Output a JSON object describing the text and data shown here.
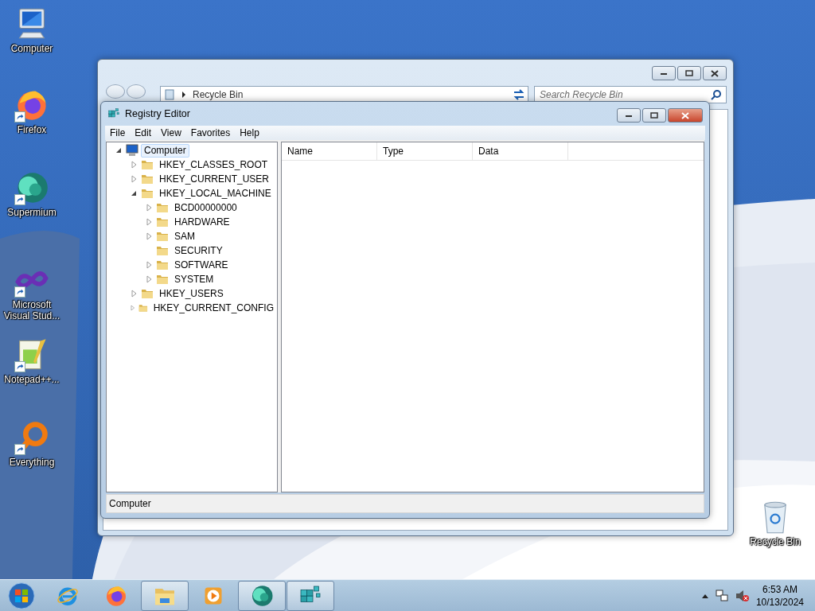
{
  "desktop_icons": [
    {
      "label": "Computer",
      "kind": "computer",
      "shortcut": false
    },
    {
      "label": "Firefox",
      "kind": "firefox",
      "shortcut": true
    },
    {
      "label": "Supermium",
      "kind": "supermium",
      "shortcut": true
    },
    {
      "label": "Microsoft Visual Stud...",
      "kind": "visualstudio",
      "shortcut": true
    },
    {
      "label": "Notepad++...",
      "kind": "notepad",
      "shortcut": true
    },
    {
      "label": "Everything",
      "kind": "everything",
      "shortcut": true
    },
    {
      "label": "Recycle Bin",
      "kind": "recyclebin",
      "shortcut": false
    }
  ],
  "explorer_window": {
    "address": "Recycle Bin",
    "search": {
      "placeholder": "Search Recycle Bin"
    }
  },
  "registry_editor": {
    "title": "Registry Editor",
    "menu": [
      "File",
      "Edit",
      "View",
      "Favorites",
      "Help"
    ],
    "tree": [
      {
        "label": "Computer",
        "kind": "computer",
        "selected": true,
        "expanded": true,
        "children": [
          {
            "label": "HKEY_CLASSES_ROOT",
            "kind": "folder",
            "selected": false,
            "expanded": false
          },
          {
            "label": "HKEY_CURRENT_USER",
            "kind": "folder",
            "selected": false,
            "expanded": false
          },
          {
            "label": "HKEY_LOCAL_MACHINE",
            "kind": "folder",
            "selected": false,
            "expanded": true,
            "children": [
              {
                "label": "BCD00000000",
                "kind": "folder",
                "selected": false,
                "expanded": false
              },
              {
                "label": "HARDWARE",
                "kind": "folder",
                "selected": false,
                "expanded": false
              },
              {
                "label": "SAM",
                "kind": "folder",
                "selected": false,
                "expanded": false
              },
              {
                "label": "SECURITY",
                "kind": "folder",
                "selected": false
              },
              {
                "label": "SOFTWARE",
                "kind": "folder",
                "selected": false,
                "expanded": false
              },
              {
                "label": "SYSTEM",
                "kind": "folder",
                "selected": false,
                "expanded": false
              }
            ]
          },
          {
            "label": "HKEY_USERS",
            "kind": "folder",
            "selected": false,
            "expanded": false
          },
          {
            "label": "HKEY_CURRENT_CONFIG",
            "kind": "folder",
            "selected": false,
            "expanded": false
          }
        ]
      }
    ],
    "columns": [
      "Name",
      "Type",
      "Data"
    ],
    "status_bar": "Computer"
  },
  "taskbar": {
    "items": [
      {
        "kind": "start",
        "running": false
      },
      {
        "kind": "ie",
        "running": false
      },
      {
        "kind": "firefox",
        "running": false
      },
      {
        "kind": "explorer",
        "running": true
      },
      {
        "kind": "media",
        "running": false
      },
      {
        "kind": "supermium",
        "running": true
      },
      {
        "kind": "regedit",
        "running": true
      }
    ],
    "clock": {
      "time": "6:53 AM",
      "date": "10/13/2024"
    }
  }
}
